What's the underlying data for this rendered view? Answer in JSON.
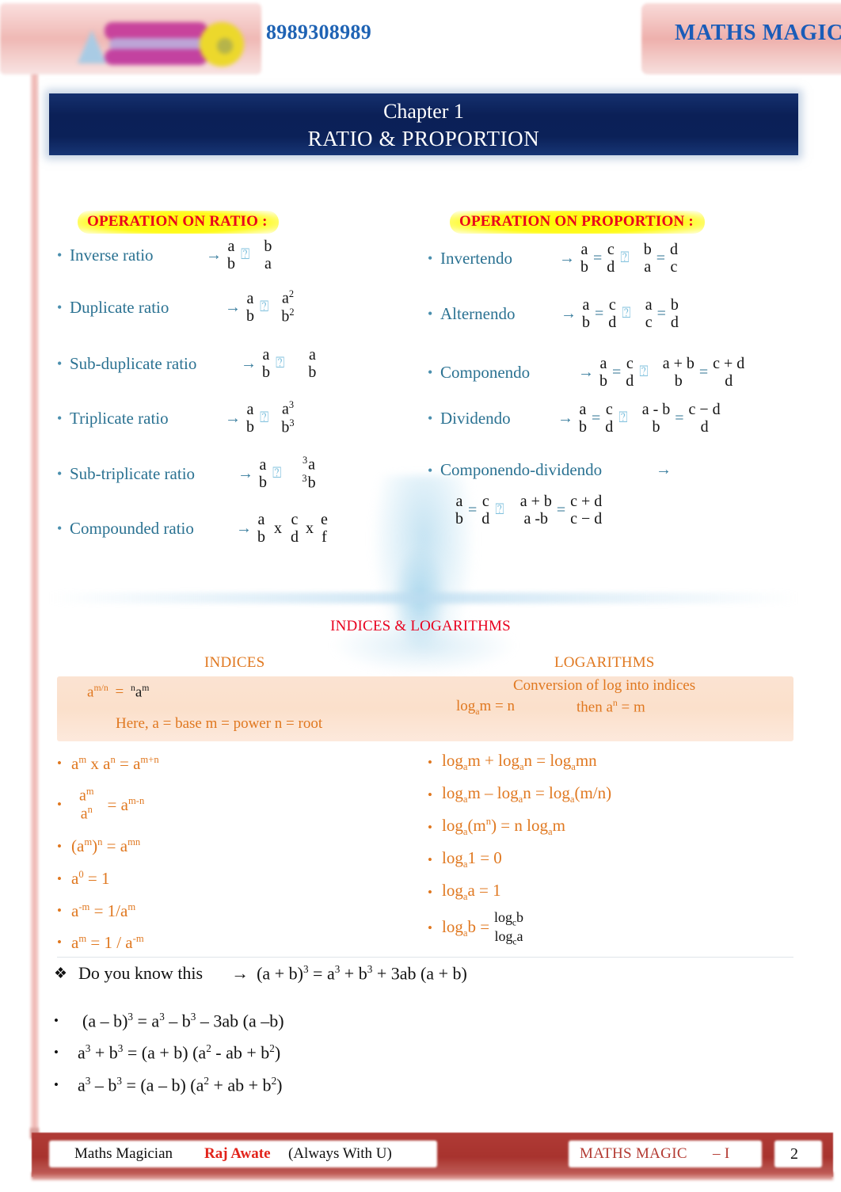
{
  "header": {
    "phone": "8989308989",
    "brand": "MATHS MAGIC",
    "logo_alt": "maths-magic-logo"
  },
  "banner": {
    "chapter": "Chapter 1",
    "title": "RATIO & PROPORTION"
  },
  "ratio_section": {
    "heading": "OPERATION ON RATIO :",
    "items": [
      {
        "label": "Inverse ratio",
        "arrow": "→",
        "lhs_num": "a",
        "lhs_den": "b",
        "op": "⍰",
        "rhs_num": "b",
        "rhs_den": "a"
      },
      {
        "label": "Duplicate ratio",
        "arrow": "→",
        "lhs_num": "a",
        "lhs_den": "b",
        "op": "⍰",
        "rhs_num": "a",
        "rhs_num_sup": "2",
        "rhs_den": "b",
        "rhs_den_sup": "2"
      },
      {
        "label": "Sub-duplicate ratio",
        "arrow": "→",
        "lhs_num": "a",
        "lhs_den": "b",
        "op": "⍰",
        "rhs_num": "a",
        "rhs_den": "b"
      },
      {
        "label": "Triplicate ratio",
        "arrow": "→",
        "lhs_num": "a",
        "lhs_den": "b",
        "op": "⍰",
        "rhs_num": "a",
        "rhs_num_sup": "3",
        "rhs_den": "b",
        "rhs_den_sup": "3"
      },
      {
        "label": "Sub-triplicate ratio",
        "arrow": "→",
        "lhs_num": "a",
        "lhs_den": "b",
        "op": "⍰",
        "rhs_num_pre": "3",
        "rhs_num": "a",
        "rhs_den_pre": "3",
        "rhs_den": "b"
      },
      {
        "label": "Compounded ratio",
        "arrow": "→",
        "f1_num": "a",
        "f1_den": "b",
        "x1": "x",
        "f2_num": "c",
        "f2_den": "d",
        "x2": "x",
        "f3_num": "e",
        "f3_den": "f"
      }
    ]
  },
  "proportion_section": {
    "heading": "OPERATION ON PROPORTION :",
    "items": [
      {
        "label": "Invertendo",
        "arrow": "→",
        "a_num": "a",
        "a_den": "b",
        "eq1": "=",
        "b_num": "c",
        "b_den": "d",
        "op": "⍰",
        "c_num": "b",
        "c_den": "a",
        "eq2": "=",
        "d_num": "d",
        "d_den": "c"
      },
      {
        "label": "Alternendo",
        "arrow": "→",
        "a_num": "a",
        "a_den": "b",
        "eq1": "=",
        "b_num": "c",
        "b_den": "d",
        "op": "⍰",
        "c_num": "a",
        "c_den": "c",
        "eq2": "=",
        "d_num": "b",
        "d_den": "d"
      },
      {
        "label": "Componendo",
        "arrow": "→",
        "a_num": "a",
        "a_den": "b",
        "eq1": "=",
        "b_num": "c",
        "b_den": "d",
        "op": "⍰",
        "c_num": "a + b",
        "c_den": "b",
        "eq2": "=",
        "d_num": "c + d",
        "d_den": "d"
      },
      {
        "label": "Dividendo",
        "arrow": "→",
        "a_num": "a",
        "a_den": "b",
        "eq1": "=",
        "b_num": "c",
        "b_den": "d",
        "op": "⍰",
        "c_num": "a - b",
        "c_den": "b",
        "eq2": "=",
        "d_num": "c − d",
        "d_den": "d"
      }
    ],
    "compdiv": {
      "label": "Componendo-dividendo",
      "arrow": "→",
      "a_num": "a",
      "a_den": "b",
      "eq1": "=",
      "b_num": "c",
      "b_den": "d",
      "op": "⍰",
      "c_num": "a + b",
      "c_den": "a -b",
      "eq2": "=",
      "d_num": "c + d",
      "d_den": "c − d"
    }
  },
  "indices_logs": {
    "section_title": "INDICES & LOGARITHMS",
    "col_left_head": "INDICES",
    "col_right_head": "LOGARITHMS",
    "box": {
      "indices_formula_base": "a",
      "indices_formula_sup": "m/n",
      "indices_formula_eq": "=",
      "indices_root_index": "n",
      "indices_root_base": "a",
      "indices_root_sup": "m",
      "indices_note": "Here,   a = base      m = power      n = root",
      "logs_title": "Conversion of log into indices",
      "logs_line_left": "log",
      "logs_line_left_sub": "a",
      "logs_line_left_rest": "m = n",
      "logs_line_right": "then a",
      "logs_line_right_sup": "n",
      "logs_line_right_rest": "= m"
    },
    "indices_rules": [
      "a<sup>m</sup> x a<sup>n</sup> = a<sup>m+n</sup>",
      "FRACTION_AM_AN",
      "(a<sup>m</sup>)<sup>n</sup> =   a<sup>mn</sup>",
      "a<sup>0</sup> = 1",
      "a<sup>-m</sup> = 1/a<sup>m</sup>",
      "a<sup>m</sup> = 1 / a<sup>-m</sup>"
    ],
    "indices_frac": {
      "num_base": "a",
      "num_sup": "m",
      "den_base": "a",
      "den_sup": "n",
      "eq": "=",
      "rhs_base": "a",
      "rhs_sup": "m-n"
    },
    "log_rules": [
      "log<sub>a</sub>m + log<sub>a</sub>n = log<sub>a</sub>mn",
      "log<sub>a</sub>m – log<sub>a</sub>n = log<sub>a</sub>(m/n)",
      "log<sub>a</sub>(m<sup>n</sup>) = n log<sub>a</sub>m",
      "log<sub>a</sub>1 = 0",
      "log<sub>a</sub>a = 1",
      "LOG_CHANGE_BASE"
    ],
    "log_change_base": {
      "lhs": "log<sub>a</sub>b =",
      "num": "log<sub>c</sub>b",
      "den": "log<sub>c</sub>a"
    }
  },
  "identities": {
    "dyk_marker": "❖",
    "dyk_label": "Do you know this",
    "dyk_arrow": "→",
    "dyk_formula": "(a + b)<sup>3</sup> = a<sup>3</sup> + b<sup>3</sup> + 3ab (a + b)",
    "bullet": "•",
    "rows": [
      "(a – b)<sup>3</sup> =  a<sup>3</sup> – b<sup>3</sup> – 3ab (a –b)",
      "a<sup>3</sup> + b<sup>3</sup> = (a + b) (a<sup>2</sup> -  ab + b<sup>2</sup>)",
      "a<sup>3</sup> – b<sup>3</sup> = (a – b) (a<sup>2</sup> + ab + b<sup>2</sup>)"
    ]
  },
  "footer": {
    "left_1": "Maths Magician",
    "left_2": "Raj Awate",
    "left_3": "(Always With U)",
    "brand": "MATHS MAGIC",
    "brand_suffix": "– I",
    "page": "2"
  }
}
